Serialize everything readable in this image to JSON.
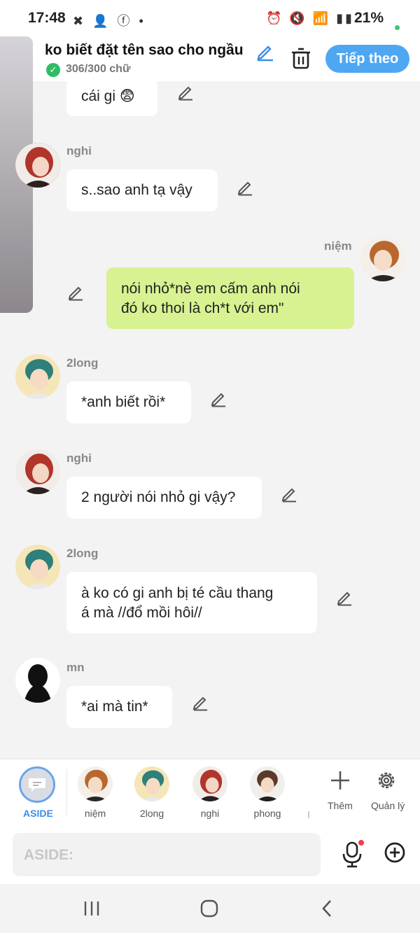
{
  "status_bar": {
    "time": "17:48",
    "battery": "21%"
  },
  "header": {
    "title": "ko biết đặt tên sao cho ngầu",
    "count": "306/300 chữ",
    "next_label": "Tiếp theo"
  },
  "messages": [
    {
      "speaker": "",
      "text": "cái gi 😨"
    },
    {
      "speaker": "nghi",
      "text": "s..sao anh tạ vậy"
    },
    {
      "speaker": "niệm",
      "line1": "nói nhỏ*nè em cấm anh nói",
      "line2": "đó ko thoi là ch*t với em\""
    },
    {
      "speaker": "2long",
      "text": "*anh biết rồi*"
    },
    {
      "speaker": "nghi",
      "text": "2 người nói nhỏ gi vậy?"
    },
    {
      "speaker": "2long",
      "line1": "à ko có gi anh bị té cầu thang",
      "line2": "á mà //đổ mồi hôi//"
    },
    {
      "speaker": "mn",
      "text": "*ai mà tin*"
    }
  ],
  "cast": {
    "aside_label": "ASIDE",
    "members": [
      "niệm",
      "2long",
      "nghi",
      "phong"
    ],
    "add_label": "Thêm",
    "manage_label": "Quản lý"
  },
  "input": {
    "placeholder": "ASIDE:"
  },
  "colors": {
    "accent": "#4ea7f3",
    "mine_bubble": "#d8f292",
    "aside": "#3a8ee6"
  }
}
